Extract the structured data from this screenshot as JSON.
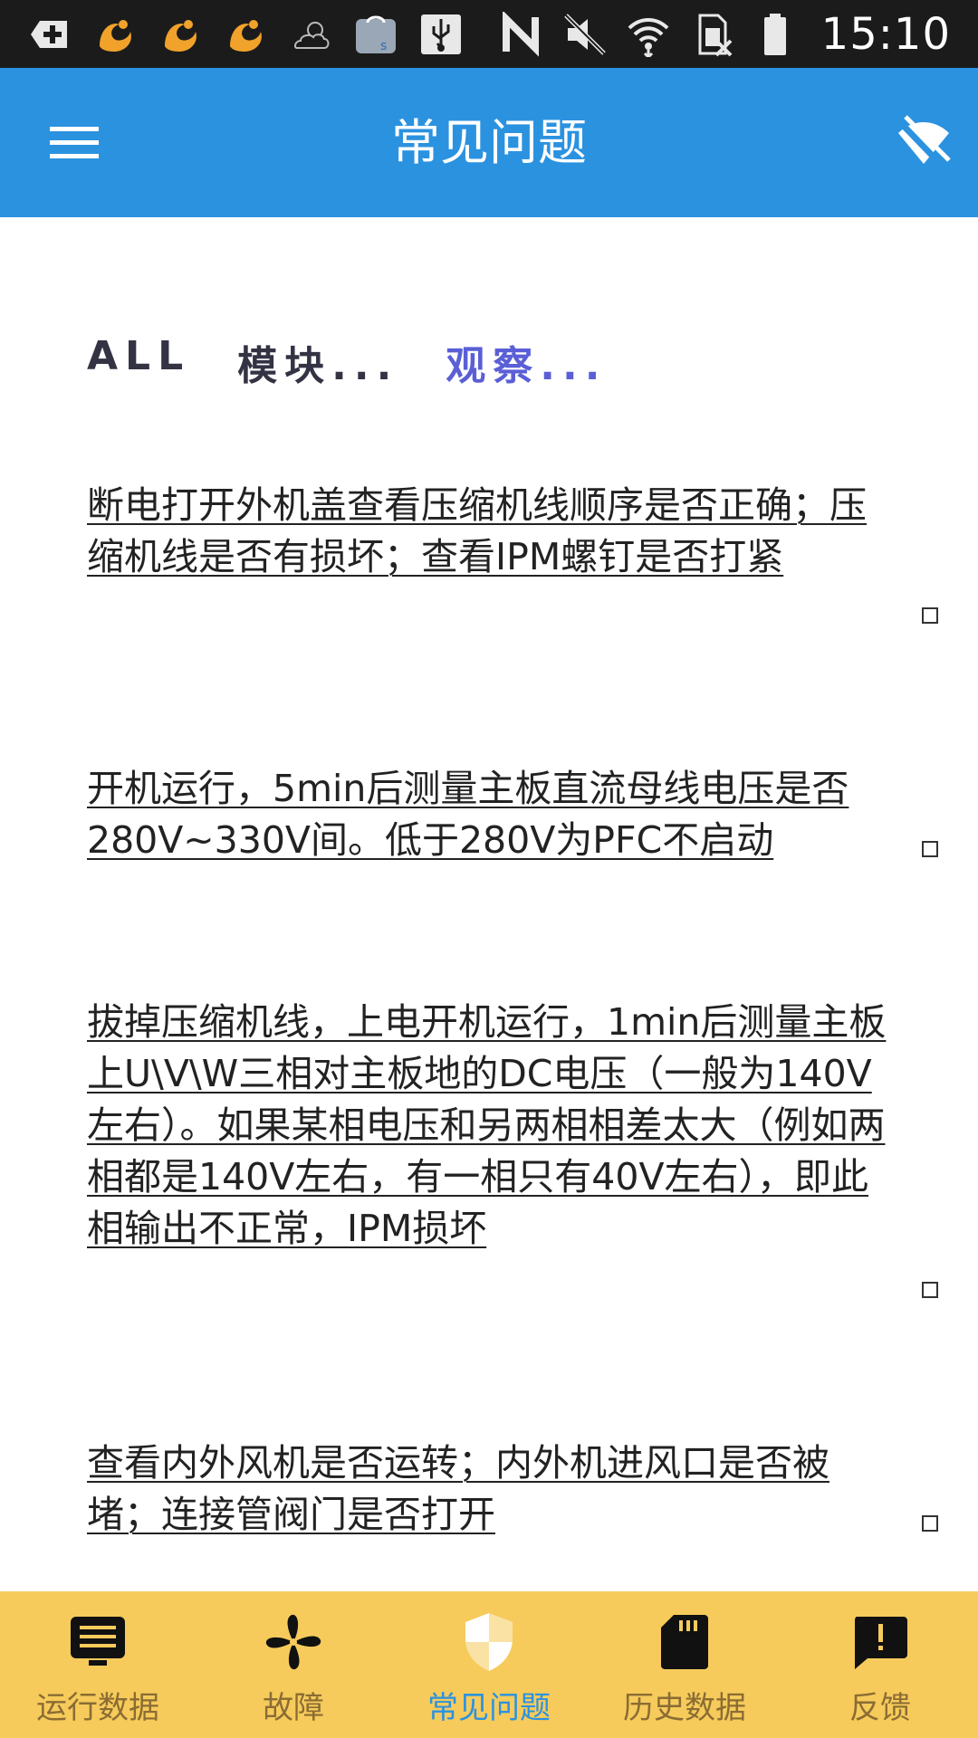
{
  "status_bar": {
    "time": "15:10",
    "left_icons": [
      "add-box-icon",
      "uc-browser-icon",
      "uc-browser-icon",
      "uc-browser-icon",
      "weather-icon",
      "shopping-bag-icon",
      "usb-icon"
    ],
    "right_icons": [
      "nfc-icon",
      "mute-icon",
      "wifi-icon",
      "no-sim-icon",
      "battery-icon"
    ]
  },
  "app_bar": {
    "title": "常见问题",
    "color": "#2b92e0"
  },
  "filters": [
    {
      "label": "ALL",
      "active": false
    },
    {
      "label": "模块...",
      "active": false
    },
    {
      "label": "观察...",
      "active": true
    }
  ],
  "faq_items": [
    {
      "text": "断电打开外机盖查看压缩机线顺序是否正确；压缩机线是否有损坏；查看IPM螺钉是否打紧",
      "checked": false
    },
    {
      "text": "开机运行，5min后测量主板直流母线电压是否280V~330V间。低于280V为PFC不启动",
      "checked": false
    },
    {
      "text": "拔掉压缩机线，上电开机运行，1min后测量主板上U\\V\\W三相对主板地的DC电压（一般为140V左右）。如果某相电压和另两相相差太大（例如两相都是140V左右，有一相只有40V左右），即此相输出不正常，IPM损坏",
      "checked": false
    },
    {
      "text": "查看内外风机是否运转；内外机进风口是否被堵；连接管阀门是否打开",
      "checked": false
    }
  ],
  "bottom_nav": {
    "items": [
      {
        "label": "运行数据",
        "icon": "monitor-icon",
        "active": false
      },
      {
        "label": "故障",
        "icon": "fan-icon",
        "active": false
      },
      {
        "label": "常见问题",
        "icon": "shield-icon",
        "active": true
      },
      {
        "label": "历史数据",
        "icon": "sd-card-icon",
        "active": false
      },
      {
        "label": "反馈",
        "icon": "feedback-icon",
        "active": false
      }
    ],
    "background": "#f6cb5b",
    "active_color": "#2b92e0"
  }
}
